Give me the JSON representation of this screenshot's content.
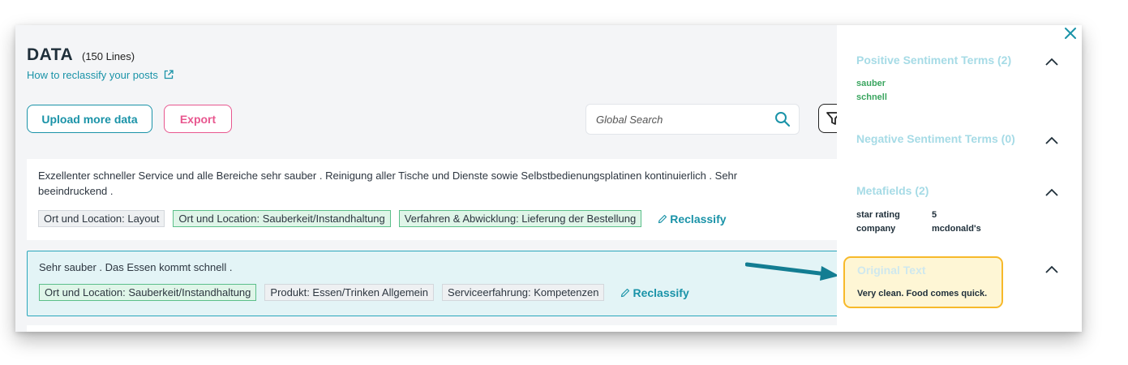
{
  "header": {
    "title": "DATA",
    "line_count": "(150 Lines)",
    "help_link": "How to reclassify your posts"
  },
  "toolbar": {
    "upload_label": "Upload more data",
    "export_label": "Export",
    "search_placeholder": "Global Search"
  },
  "rows": [
    {
      "text": "Exzellenter schneller Service und alle Bereiche sehr sauber . Reinigung aller Tische und Dienste sowie Selbstbedienungsplatinen kontinuierlich . Sehr beeindruckend .",
      "tags": [
        {
          "label": "Ort und Location: Layout",
          "style": "grey"
        },
        {
          "label": "Ort und Location: Sauberkeit/Instandhaltung",
          "style": "green"
        },
        {
          "label": "Verfahren & Abwicklung: Lieferung der Bestellung",
          "style": "green"
        }
      ],
      "reclassify_label": "Reclassify"
    },
    {
      "text": "Sehr sauber . Das Essen kommt schnell .",
      "tags": [
        {
          "label": "Ort und Location: Sauberkeit/Instandhaltung",
          "style": "green"
        },
        {
          "label": "Produkt: Essen/Trinken Allgemein",
          "style": "grey"
        },
        {
          "label": "Serviceerfahrung: Kompetenzen",
          "style": "grey"
        }
      ],
      "reclassify_label": "Reclassify",
      "selected": true
    }
  ],
  "panel": {
    "positive_title": "Positive Sentiment Terms (2)",
    "positive_terms": [
      "sauber",
      "schnell"
    ],
    "negative_title": "Negative Sentiment Terms (0)",
    "metafields_title": "Metafields (2)",
    "metafields": [
      {
        "key": "star rating",
        "value": "5"
      },
      {
        "key": "company",
        "value": "mcdonald's"
      }
    ],
    "original_title": "Original Text",
    "original_text": "Very clean. Food comes quick."
  },
  "colors": {
    "accent": "#1a93a8",
    "export": "#e8578f",
    "positive_term": "#3aa55f",
    "highlight_border": "#f7b92a",
    "highlight_bg": "#fef6d5"
  },
  "icons": [
    "external-link-icon",
    "search-icon",
    "filter-icon",
    "pencil-icon",
    "chevron-up-icon",
    "close-icon",
    "arrow-icon"
  ]
}
